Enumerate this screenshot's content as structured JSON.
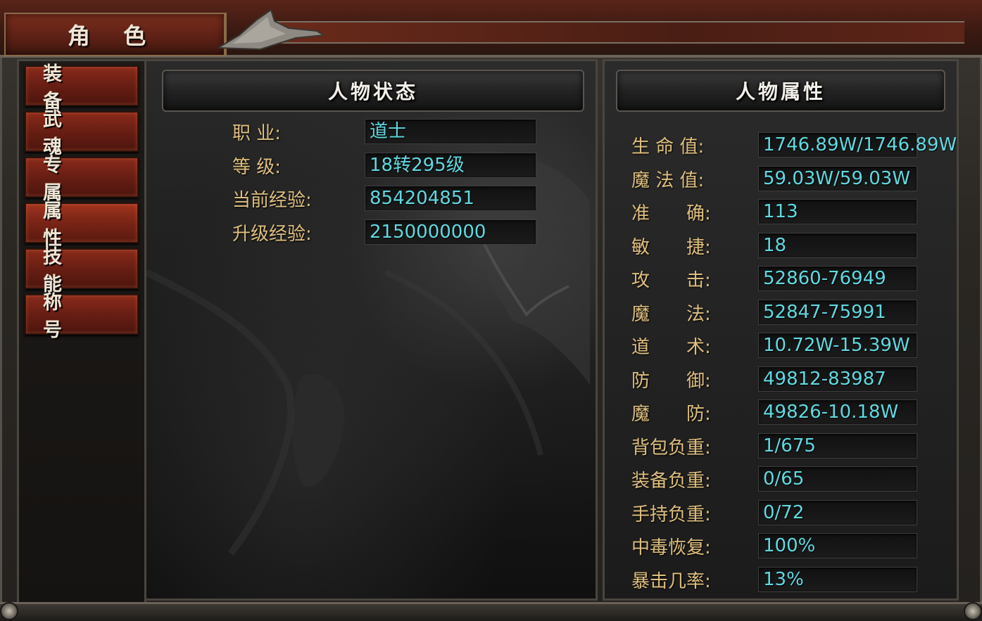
{
  "window": {
    "title": "角 色"
  },
  "tabs": [
    {
      "label": "装 备"
    },
    {
      "label": "武 魂"
    },
    {
      "label": "专 属"
    },
    {
      "label": "属 性"
    },
    {
      "label": "技 能"
    },
    {
      "label": "称 号"
    }
  ],
  "status_panel": {
    "header": "人物状态",
    "rows": [
      {
        "label": "职 业:",
        "value": "道士"
      },
      {
        "label": "等 级:",
        "value": "18转295级"
      },
      {
        "label": "当前经验:",
        "value": "854204851"
      },
      {
        "label": "升级经验:",
        "value": "2150000000"
      }
    ]
  },
  "attributes_panel": {
    "header": "人物属性",
    "rows": [
      {
        "label": "生 命 值:",
        "value": "1746.89W/1746.89W"
      },
      {
        "label": "魔 法 值:",
        "value": "59.03W/59.03W"
      },
      {
        "label": "准　　确:",
        "value": "113"
      },
      {
        "label": "敏　　捷:",
        "value": "18"
      },
      {
        "label": "攻　　击:",
        "value": "52860-76949"
      },
      {
        "label": "魔　　法:",
        "value": "52847-75991"
      },
      {
        "label": "道　　术:",
        "value": "10.72W-15.39W"
      },
      {
        "label": "防　　御:",
        "value": "49812-83987"
      },
      {
        "label": "魔　　防:",
        "value": "49826-10.18W"
      },
      {
        "label": "背包负重:",
        "value": "1/675"
      },
      {
        "label": "装备负重:",
        "value": "0/65"
      },
      {
        "label": "手持负重:",
        "value": "0/72"
      },
      {
        "label": "中毒恢复:",
        "value": "100%"
      },
      {
        "label": "暴击几率:",
        "value": "13%"
      }
    ]
  },
  "colors": {
    "label_gold": "#dfbf7e",
    "value_cyan": "#5fd9e0",
    "tab_red": "#7c2516"
  }
}
